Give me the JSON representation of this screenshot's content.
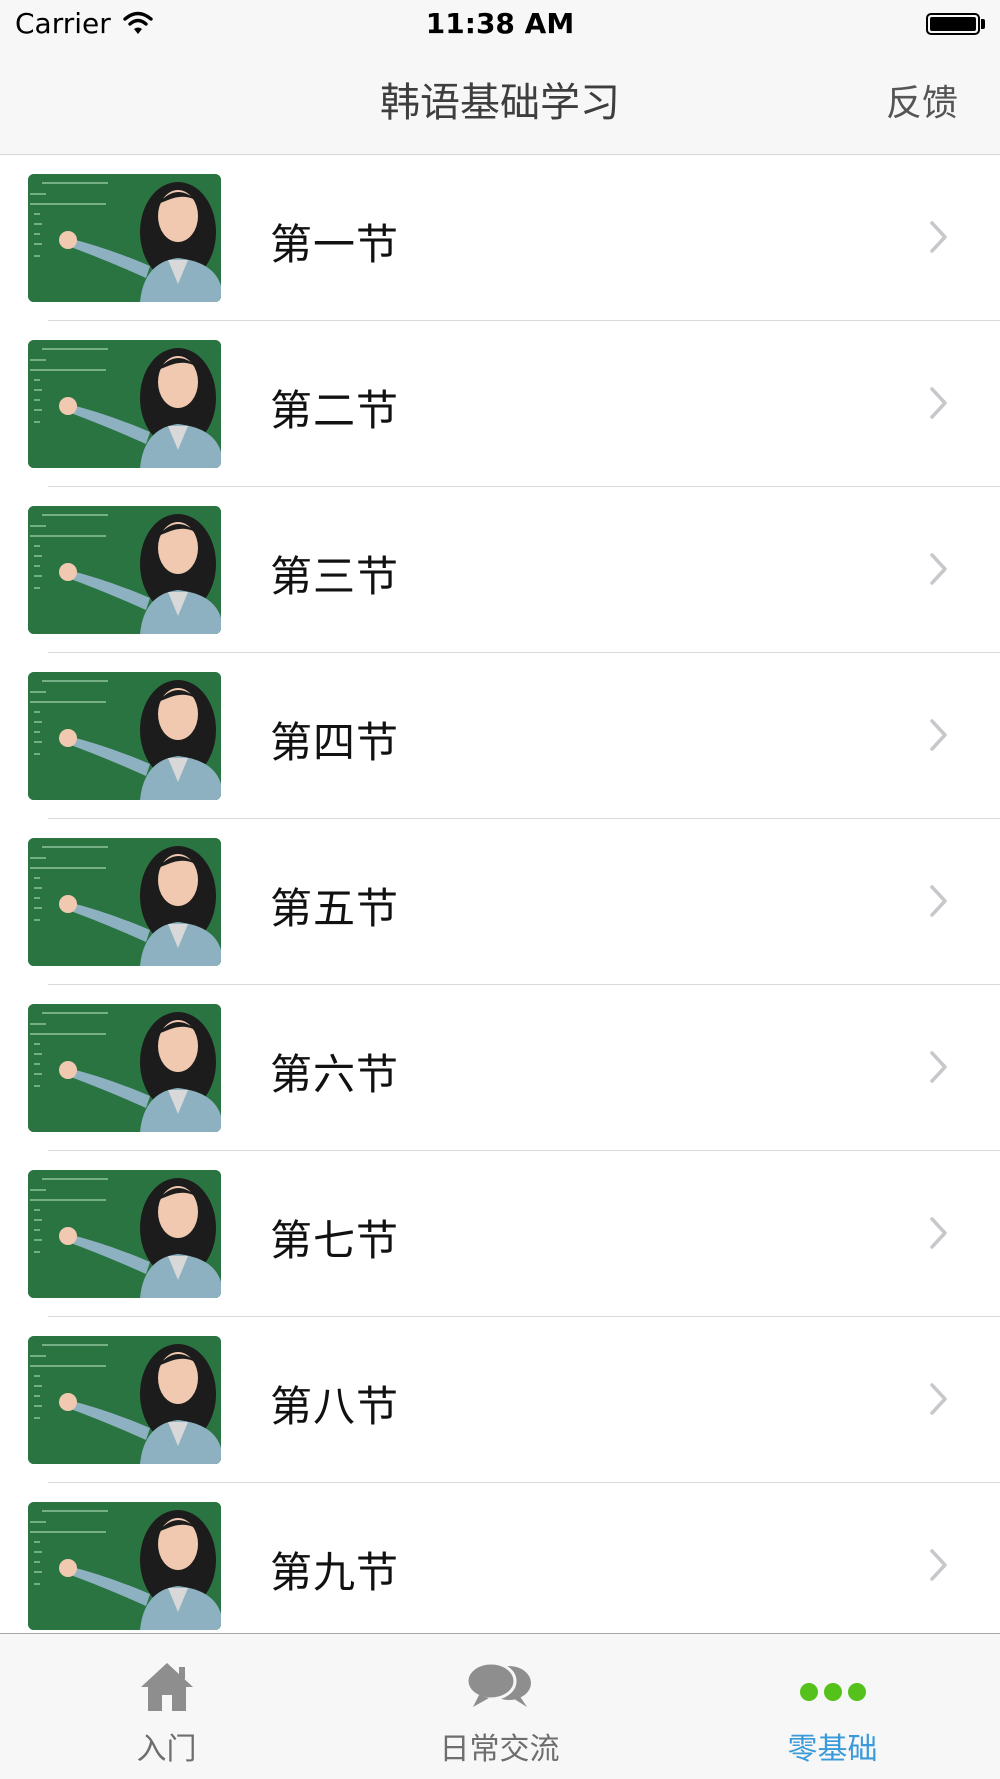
{
  "status_bar": {
    "carrier": "Carrier",
    "time": "11:38 AM"
  },
  "nav": {
    "title": "韩语基础学习",
    "right_button": "反馈"
  },
  "lessons": [
    {
      "label": "第一节"
    },
    {
      "label": "第二节"
    },
    {
      "label": "第三节"
    },
    {
      "label": "第四节"
    },
    {
      "label": "第五节"
    },
    {
      "label": "第六节"
    },
    {
      "label": "第七节"
    },
    {
      "label": "第八节"
    },
    {
      "label": "第九节"
    }
  ],
  "tabs": [
    {
      "label": "入门",
      "icon": "home-icon",
      "active": false
    },
    {
      "label": "日常交流",
      "icon": "chat-bubbles-icon",
      "active": false
    },
    {
      "label": "零基础",
      "icon": "more-dots-icon",
      "active": true
    }
  ],
  "colors": {
    "active_tab_text": "#3a9ad9",
    "active_tab_icon": "#55c21b",
    "inactive_tab": "#8e8e8e",
    "chalkboard": "#2a7442"
  }
}
